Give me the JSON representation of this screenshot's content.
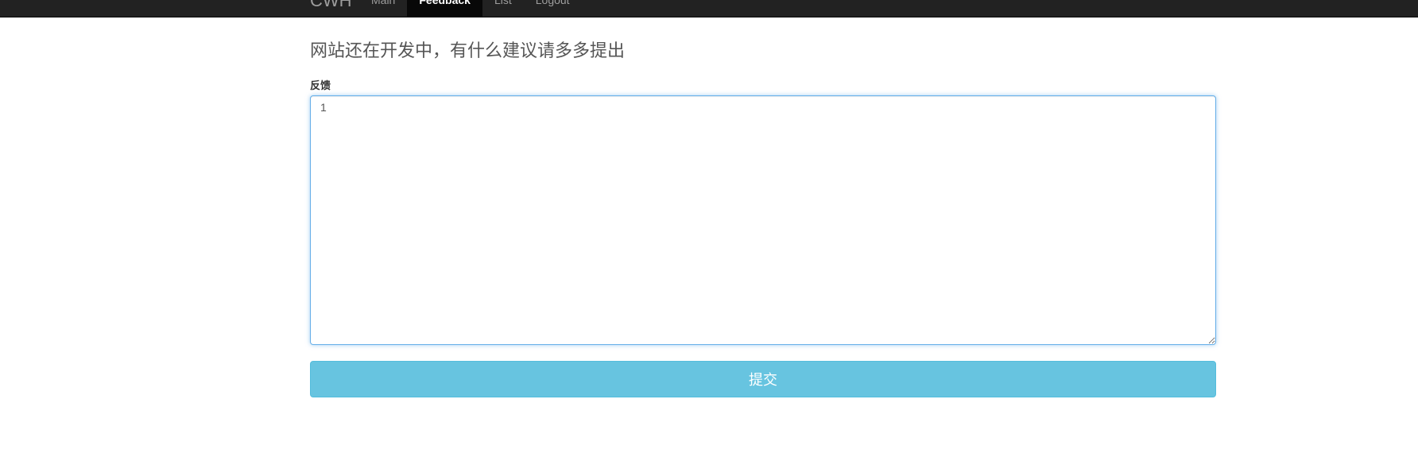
{
  "navbar": {
    "brand": "CWH",
    "links": [
      {
        "label": "Main",
        "active": false
      },
      {
        "label": "Feedback",
        "active": true
      },
      {
        "label": "List",
        "active": false
      },
      {
        "label": "Logout",
        "active": false
      }
    ]
  },
  "main": {
    "title": "网站还在开发中，有什么建议请多多提出",
    "feedback": {
      "label": "反馈",
      "value": "1"
    },
    "submit_label": "提交"
  },
  "colors": {
    "navbar_bg": "#222222",
    "submit_bg": "#5bc0de",
    "focus_border": "#66afe9"
  }
}
